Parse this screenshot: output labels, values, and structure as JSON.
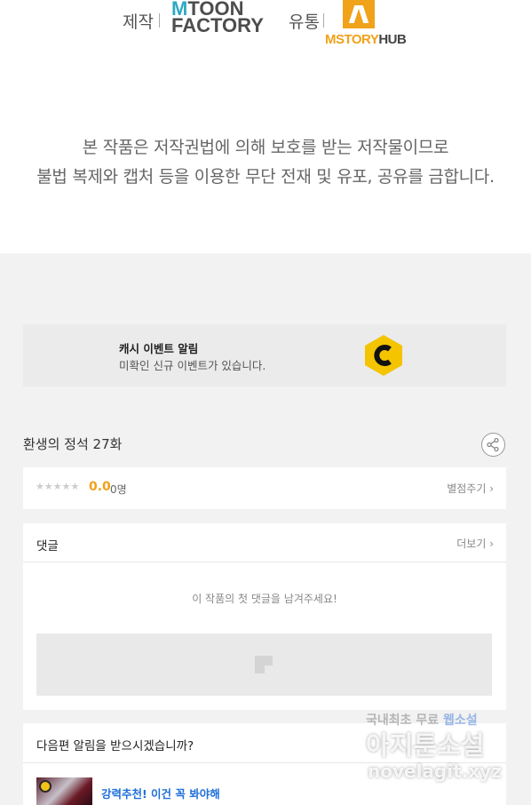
{
  "credits": {
    "production_label": "제작",
    "production_logo_line1_m": "M",
    "production_logo_line1_rest": "TOON",
    "production_logo_line2": "FACTORY",
    "distribution_label": "유통",
    "distribution_logo_a": "MSTORY",
    "distribution_logo_b": "HUB"
  },
  "copyright": {
    "line1": "본 작품은 저작권법에 의해 보호를 받는 저작물이므로",
    "line2": "불법 복제와 캡처 등을 이용한 무단 전재 및 유포, 공유를 금합니다."
  },
  "event_banner": {
    "title": "캐시 이벤트 알림",
    "subtitle": "미확인 신규 이벤트가 있습니다.",
    "logo_letter": "C",
    "logo_color": "#f5c400"
  },
  "episode": {
    "title": "환생의 정석 27화",
    "share_icon": "share-icon"
  },
  "rating": {
    "stars": "★★★★★",
    "score": "0.0",
    "raters": "0명",
    "rate_link": "별점주기 ›"
  },
  "comments": {
    "title": "댓글",
    "more_link": "더보기 ›",
    "empty_message": "이 작품의 첫 댓글을 남겨주세요!"
  },
  "notify": {
    "title": "다음편 알림을 받으시겠습니까?",
    "promo_title": "강력추천! 이건 꼭 봐야해"
  },
  "watermark": {
    "line1_a": "국내최초 무료 ",
    "line1_b": "웹소설",
    "line2": "아지툰소설",
    "line3": "novelagit.xyz"
  },
  "colors": {
    "accent_orange": "#f0a21a",
    "link_blue": "#1e6fd9",
    "page_gray": "#f2f2f2"
  }
}
